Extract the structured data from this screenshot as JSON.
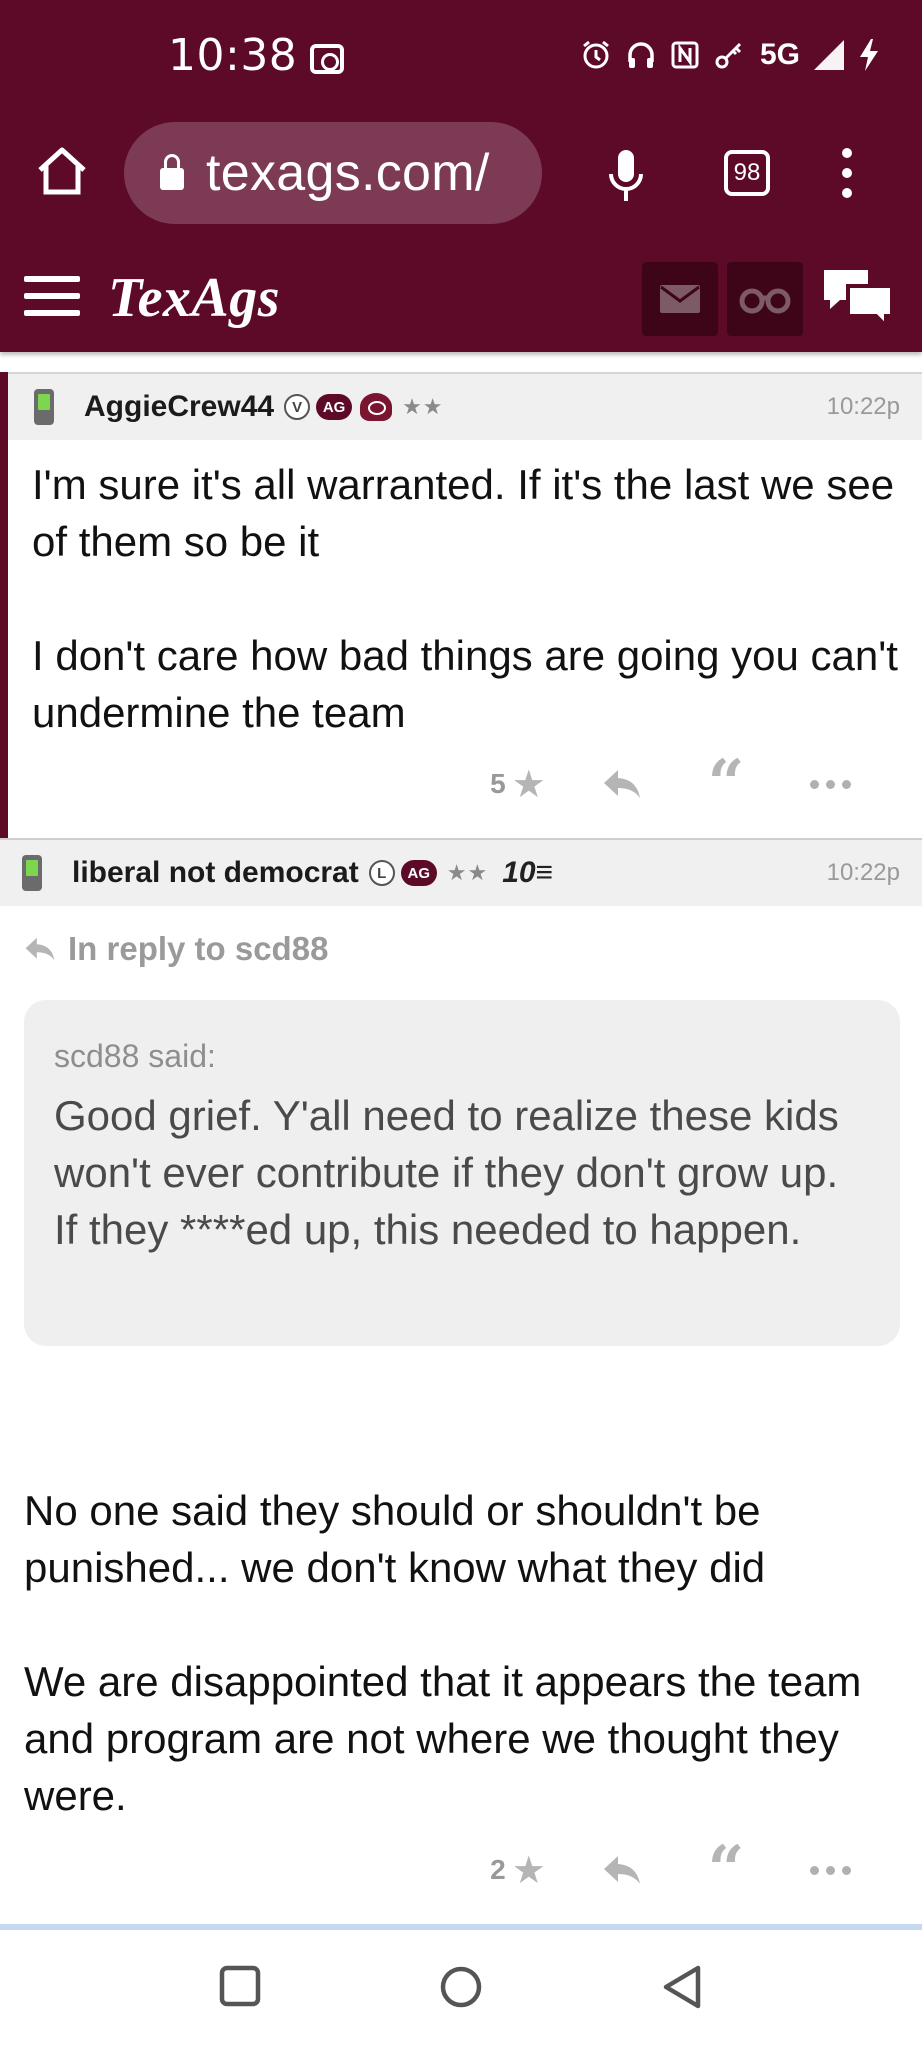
{
  "status_bar": {
    "time": "10:38",
    "network": "5G",
    "icons": [
      "screen-record-icon",
      "alarm-icon",
      "headphones-icon",
      "nfc-icon",
      "key-icon",
      "signal-icon",
      "charging-icon"
    ]
  },
  "browser": {
    "url": "texags.com/",
    "tab_count": "98",
    "icons": [
      "home-icon",
      "lock-icon",
      "mic-icon",
      "tabs-icon",
      "more-vert-icon"
    ]
  },
  "site_header": {
    "logo": "TexAgs",
    "icons": [
      "hamburger-icon",
      "mail-icon",
      "binoculars-icon",
      "chat-icon"
    ],
    "colors": {
      "brand": "#5c0a28",
      "button_dark": "#3e0518"
    }
  },
  "posts": [
    {
      "username": "AggieCrew44",
      "badge_letter": "V",
      "ag_badge": "AG",
      "stars": "★★",
      "time": "10:22p",
      "body_lines": [
        "I'm sure it's all warranted. If it's the last we see of them so be it",
        "",
        "I don't care how bad things are going you can't undermine the team"
      ],
      "star_count": "5"
    },
    {
      "username": "liberal not democrat",
      "badge_letter": "L",
      "ag_badge": "AG",
      "stars": "★★",
      "tenure_badge": "10≡",
      "time": "10:22p",
      "reply_to": "In reply to scd88",
      "quote_author": "scd88 said:",
      "quote_text": "Good grief. Y'all need to realize these kids won't ever contribute if they don't grow up. If they ****ed up, this needed to happen.",
      "body_lines": [
        "No one said they should or shouldn't be punished... we don't know what they did",
        "",
        "We are disappointed that it appears the team and program are not where we thought they were."
      ],
      "star_count": "2"
    }
  ],
  "nav_bar": {
    "icons": [
      "recents-icon",
      "home-circle-icon",
      "back-icon"
    ]
  }
}
